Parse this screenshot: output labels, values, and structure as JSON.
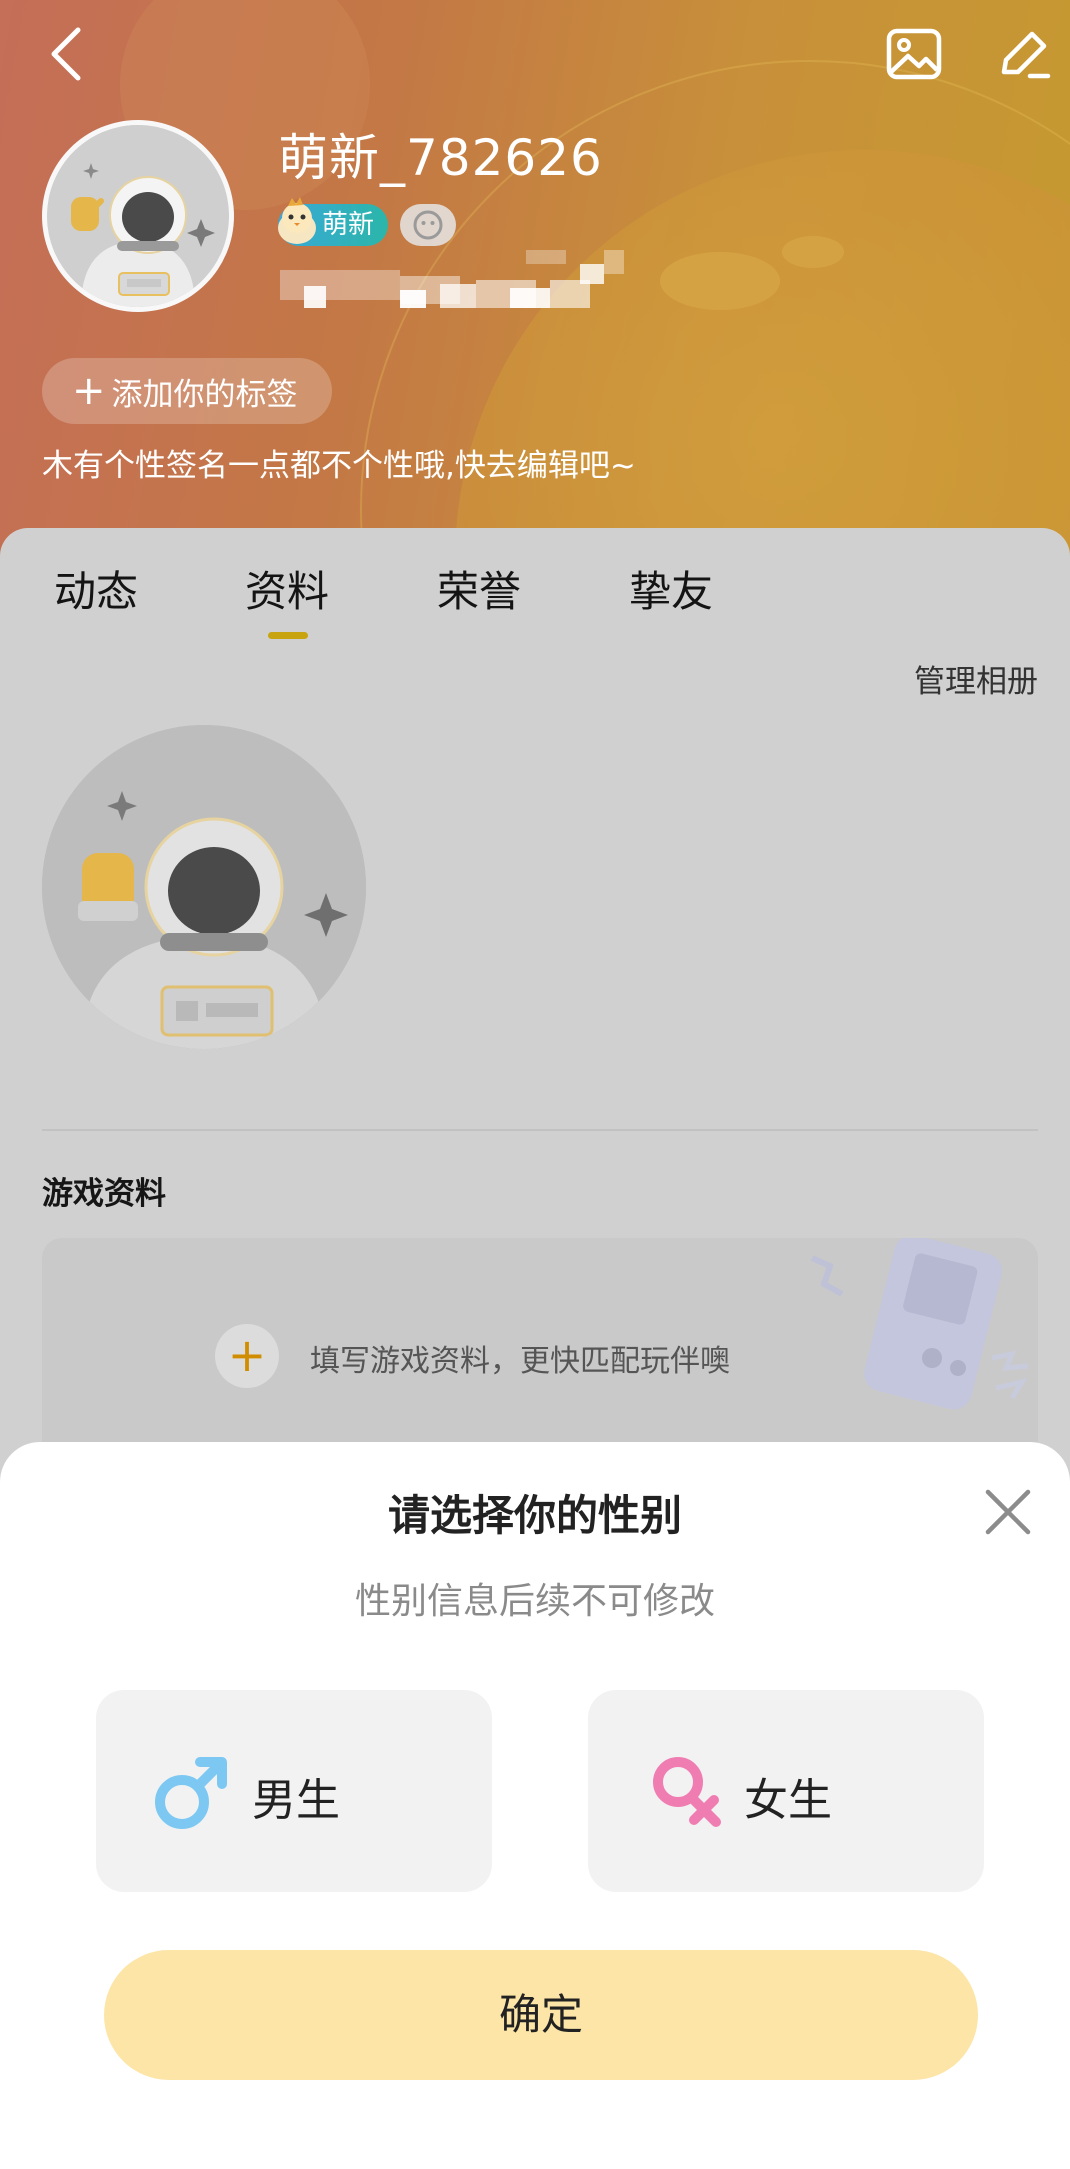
{
  "header": {
    "username": "萌新_782626",
    "level_badge": "萌新",
    "add_tag_label": "添加你的标签",
    "signature": "木有个性签名一点都不个性哦,快去编辑吧~"
  },
  "tabs": [
    {
      "label": "动态"
    },
    {
      "label": "资料"
    },
    {
      "label": "荣誉"
    },
    {
      "label": "挚友"
    }
  ],
  "album": {
    "manage_label": "管理相册"
  },
  "game_profile": {
    "title": "游戏资料",
    "hint": "填写游戏资料，更快匹配玩伴噢"
  },
  "gender_sheet": {
    "title": "请选择你的性别",
    "subtitle": "性别信息后续不可修改",
    "male_label": "男生",
    "female_label": "女生",
    "confirm_label": "确定"
  },
  "colors": {
    "tab_indicator": "#c8a410",
    "confirm_bg": "#fce5a7",
    "male_icon": "#7cc8f2",
    "female_icon": "#f07db2"
  },
  "icons": [
    "back-arrow-icon",
    "image-icon",
    "edit-pencil-icon",
    "close-icon",
    "male-icon",
    "female-icon",
    "plus-icon"
  ]
}
